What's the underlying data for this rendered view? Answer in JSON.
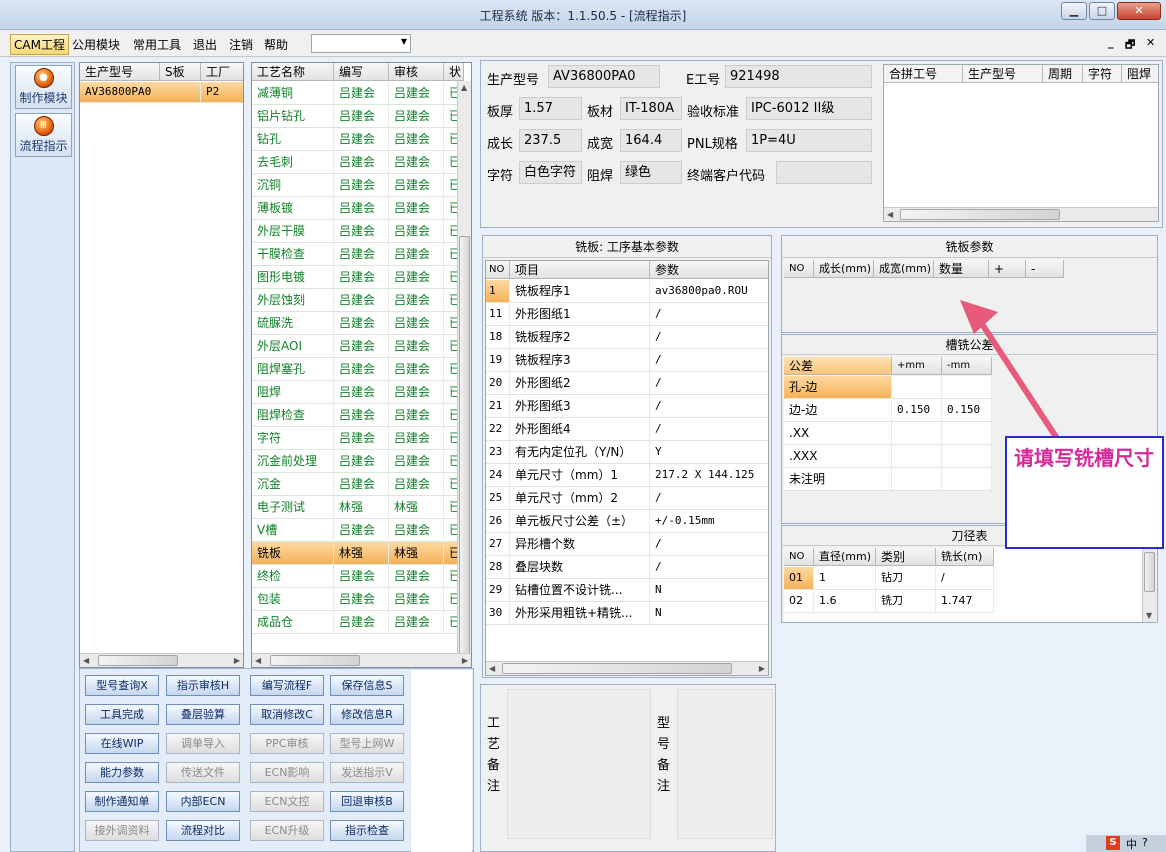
{
  "window": {
    "title": "工程系统  版本：1.1.50.5 - [流程指示]",
    "min": "▁",
    "max": "□",
    "close": "✕"
  },
  "menu": {
    "items": [
      "CAM工程",
      "公用模块",
      "常用工具",
      "退出",
      "注销",
      "帮助"
    ],
    "combo": "",
    "mdi": [
      "_",
      "🗗",
      "✕"
    ]
  },
  "launcher": {
    "items": [
      "制作模块",
      "流程指示"
    ]
  },
  "modelgrid": {
    "headers": [
      "生产型号",
      "S板",
      "工厂"
    ],
    "rows": [
      [
        "AV36800PA0",
        "",
        "P2"
      ]
    ]
  },
  "processgrid": {
    "headers": [
      "工艺名称",
      "编写",
      "审核",
      "状"
    ],
    "rows": [
      [
        "减薄铜",
        "吕建会",
        "吕建会",
        "已"
      ],
      [
        "铝片钻孔",
        "吕建会",
        "吕建会",
        "已"
      ],
      [
        "钻孔",
        "吕建会",
        "吕建会",
        "已"
      ],
      [
        "去毛刺",
        "吕建会",
        "吕建会",
        "已"
      ],
      [
        "沉铜",
        "吕建会",
        "吕建会",
        "已"
      ],
      [
        "薄板镀",
        "吕建会",
        "吕建会",
        "已"
      ],
      [
        "外层干膜",
        "吕建会",
        "吕建会",
        "已"
      ],
      [
        "干膜检查",
        "吕建会",
        "吕建会",
        "已"
      ],
      [
        "图形电镀",
        "吕建会",
        "吕建会",
        "已"
      ],
      [
        "外层蚀刻",
        "吕建会",
        "吕建会",
        "已"
      ],
      [
        "硫脲洗",
        "吕建会",
        "吕建会",
        "已"
      ],
      [
        "外层AOI",
        "吕建会",
        "吕建会",
        "已"
      ],
      [
        "阻焊塞孔",
        "吕建会",
        "吕建会",
        "已"
      ],
      [
        "阻焊",
        "吕建会",
        "吕建会",
        "已"
      ],
      [
        "阻焊检查",
        "吕建会",
        "吕建会",
        "已"
      ],
      [
        "字符",
        "吕建会",
        "吕建会",
        "已"
      ],
      [
        "沉金前处理",
        "吕建会",
        "吕建会",
        "已"
      ],
      [
        "沉金",
        "吕建会",
        "吕建会",
        "已"
      ],
      [
        "电子测试",
        "林强",
        "林强",
        "已"
      ],
      [
        "V槽",
        "吕建会",
        "吕建会",
        "已"
      ],
      [
        "铣板",
        "林强",
        "林强",
        "已"
      ],
      [
        "终检",
        "吕建会",
        "吕建会",
        "已"
      ],
      [
        "包装",
        "吕建会",
        "吕建会",
        "已"
      ],
      [
        "成品仓",
        "吕建会",
        "吕建会",
        "已"
      ]
    ],
    "selected": 20
  },
  "buttons": [
    {
      "label": "型号查询X",
      "enabled": true
    },
    {
      "label": "指示审核H",
      "enabled": true
    },
    {
      "label": "编写流程F",
      "enabled": true
    },
    {
      "label": "保存信息S",
      "enabled": true
    },
    {
      "label": "工具完成",
      "enabled": true
    },
    {
      "label": "叠层验算",
      "enabled": true
    },
    {
      "label": "取消修改C",
      "enabled": true
    },
    {
      "label": "修改信息R",
      "enabled": true
    },
    {
      "label": "在线WIP",
      "enabled": true
    },
    {
      "label": "调单导入",
      "enabled": false
    },
    {
      "label": "PPC审核",
      "enabled": false
    },
    {
      "label": "型号上网W",
      "enabled": false
    },
    {
      "label": "能力参数",
      "enabled": true
    },
    {
      "label": "传送文件",
      "enabled": false
    },
    {
      "label": "ECN影响",
      "enabled": false
    },
    {
      "label": "发送指示V",
      "enabled": false
    },
    {
      "label": "制作通知单",
      "enabled": true
    },
    {
      "label": "内部ECN",
      "enabled": true
    },
    {
      "label": "ECN文控",
      "enabled": false
    },
    {
      "label": "回退审核B",
      "enabled": true
    },
    {
      "label": "接外调资料",
      "enabled": false
    },
    {
      "label": "流程对比",
      "enabled": true
    },
    {
      "label": "ECN升级",
      "enabled": false
    },
    {
      "label": "指示检查",
      "enabled": true
    }
  ],
  "info": {
    "production_model_label": "生产型号",
    "production_model": "AV36800PA0",
    "e_no_label": "E工号",
    "e_no": "921498",
    "thickness_label": "板厚",
    "thickness": "1.57",
    "material_label": "板材",
    "material": "IT-180A",
    "standard_label": "验收标准",
    "standard": "IPC-6012 II级",
    "length_label": "成长",
    "length": "237.5",
    "width_label": "成宽",
    "width": "164.4",
    "pnl_label": "PNL规格",
    "pnl": "1P=4U",
    "char_label": "字符",
    "char": "白色字符",
    "mask_label": "阻焊",
    "mask": "绿色",
    "customer_label": "终端客户代码",
    "customer": ""
  },
  "mergegrid": {
    "headers": [
      "合拼工号",
      "生产型号",
      "周期",
      "字符",
      "阻焊"
    ]
  },
  "millparams": {
    "title": "铣板: 工序基本参数",
    "headers": [
      "NO",
      "项目",
      "参数"
    ],
    "rows": [
      [
        "1",
        "铣板程序1",
        "av36800pa0.ROU"
      ],
      [
        "11",
        "外形图纸1",
        "/"
      ],
      [
        "18",
        "铣板程序2",
        "/"
      ],
      [
        "19",
        "铣板程序3",
        "/"
      ],
      [
        "20",
        "外形图纸2",
        "/"
      ],
      [
        "21",
        "外形图纸3",
        "/"
      ],
      [
        "22",
        "外形图纸4",
        "/"
      ],
      [
        "23",
        "有无内定位孔（Y/N）",
        "Y"
      ],
      [
        "24",
        "单元尺寸（mm）1",
        "217.2 X 144.125"
      ],
      [
        "25",
        "单元尺寸（mm）2",
        "/"
      ],
      [
        "26",
        "单元板尺寸公差（±）",
        "+/-0.15mm"
      ],
      [
        "27",
        "异形槽个数",
        "/"
      ],
      [
        "28",
        "叠层块数",
        "/"
      ],
      [
        "29",
        "钻槽位置不设计铣...",
        "N"
      ],
      [
        "30",
        "外形采用粗铣+精铣...",
        "N"
      ]
    ]
  },
  "millboard": {
    "title": "铣板参数",
    "headers": [
      "NO",
      "成长(mm)",
      "成宽(mm)",
      "数量",
      "+",
      "-"
    ]
  },
  "slottol": {
    "title": "槽铣公差",
    "headers": [
      "公差",
      "+mm",
      "-mm"
    ],
    "rows": [
      [
        "孔-边",
        "",
        ""
      ],
      [
        "边-边",
        "0.150",
        "0.150"
      ],
      [
        ".XX",
        "",
        ""
      ],
      [
        ".XXX",
        "",
        ""
      ],
      [
        "未注明",
        "",
        ""
      ]
    ]
  },
  "tools": {
    "title": "刀径表",
    "headers": [
      "NO",
      "直径(mm)",
      "类别",
      "铣长(m)"
    ],
    "rows": [
      [
        "01",
        "1",
        "钻刀",
        "/"
      ],
      [
        "02",
        "1.6",
        "铣刀",
        "1.747"
      ]
    ]
  },
  "remarks": {
    "process_label": "工艺备注",
    "model_label": "型号备注"
  },
  "annotation": {
    "text": "请填写铣槽尺寸",
    "color": "#d42a9a",
    "arrow_color": "#e85a7a"
  }
}
